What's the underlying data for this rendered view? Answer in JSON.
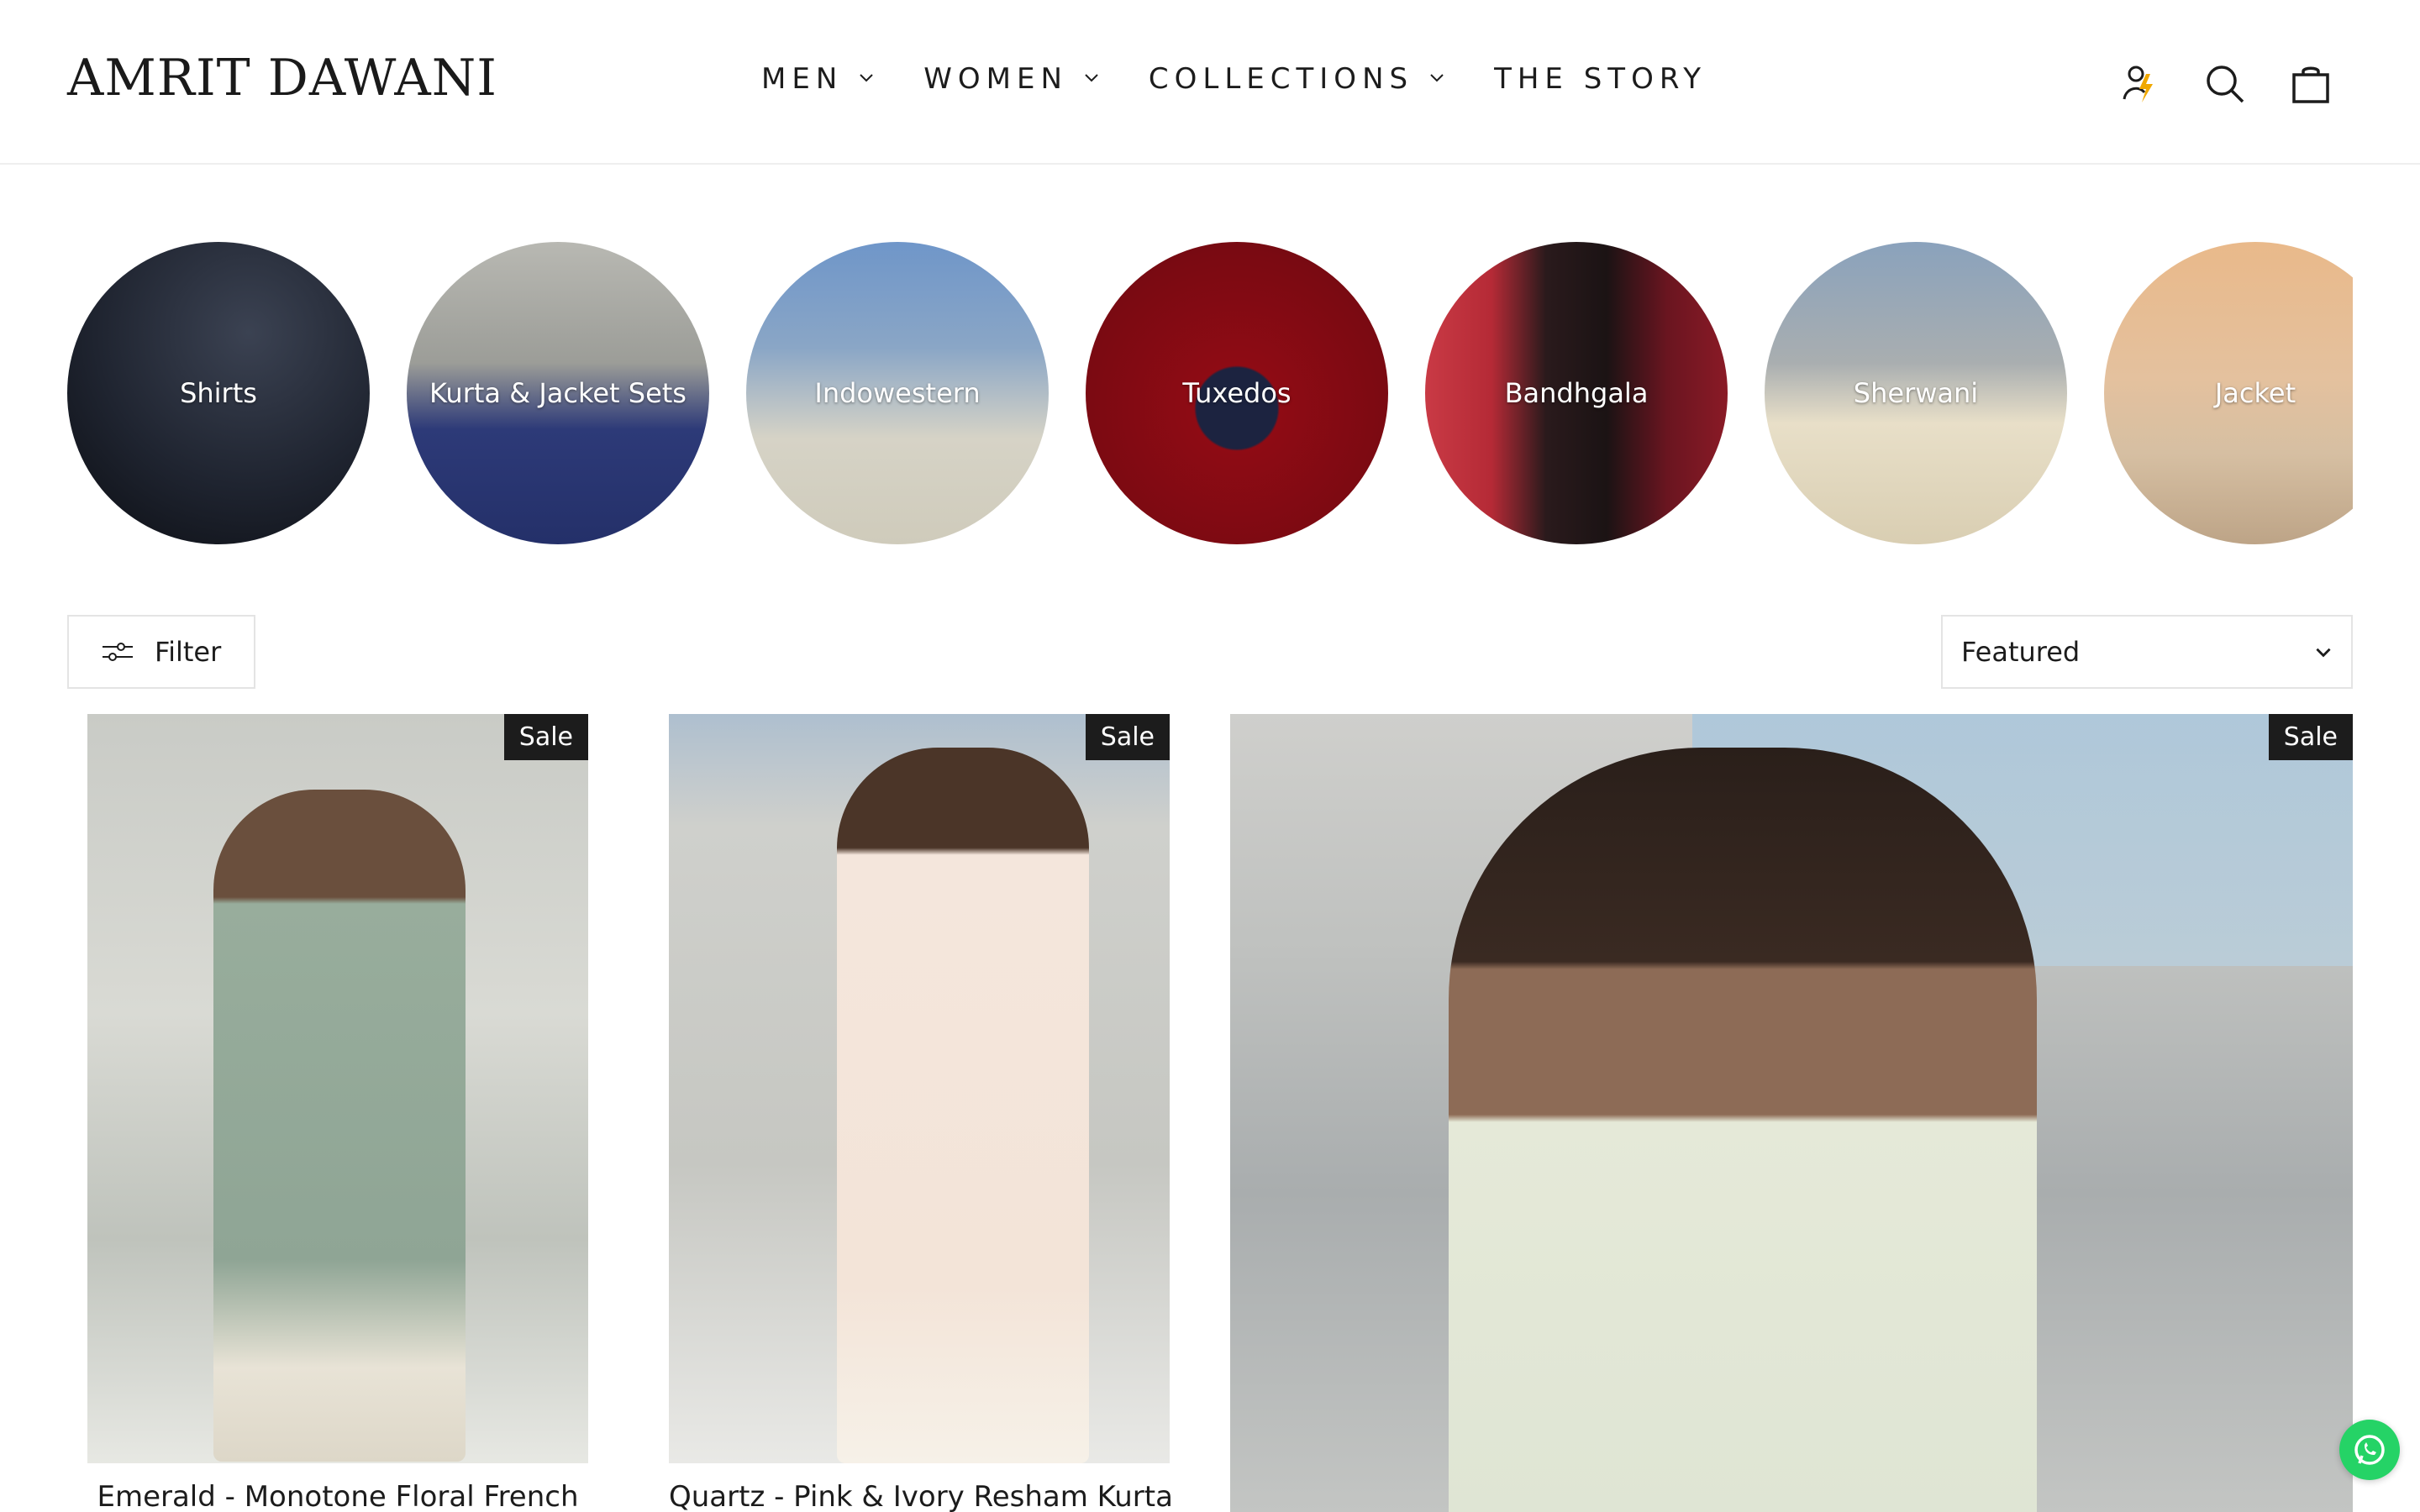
{
  "brand": {
    "logo": "AMRIT DAWANI"
  },
  "nav": [
    {
      "label": "MEN",
      "has_dropdown": true
    },
    {
      "label": "WOMEN",
      "has_dropdown": true
    },
    {
      "label": "COLLECTIONS",
      "has_dropdown": true
    },
    {
      "label": "THE STORY",
      "has_dropdown": false
    }
  ],
  "header_icons": [
    "account-icon",
    "search-icon",
    "cart-icon"
  ],
  "categories": [
    {
      "label": "Shirts"
    },
    {
      "label": "Kurta & Jacket Sets"
    },
    {
      "label": "Indowestern"
    },
    {
      "label": "Tuxedos"
    },
    {
      "label": "Bandhgala"
    },
    {
      "label": "Sherwani"
    },
    {
      "label": "Jacket"
    }
  ],
  "toolbar": {
    "filter_label": "Filter",
    "sort_selected": "Featured"
  },
  "products": [
    {
      "title": "Emerald - Monotone Floral French",
      "badge": "Sale"
    },
    {
      "title": "Quartz - Pink & Ivory Resham Kurta",
      "badge": "Sale"
    },
    {
      "title": "",
      "badge": "Sale"
    }
  ],
  "colors": {
    "text": "#1c1c1c",
    "badge_bg": "#1c1c1c",
    "whatsapp": "#25d366",
    "account_bolt": "#f0a800"
  }
}
